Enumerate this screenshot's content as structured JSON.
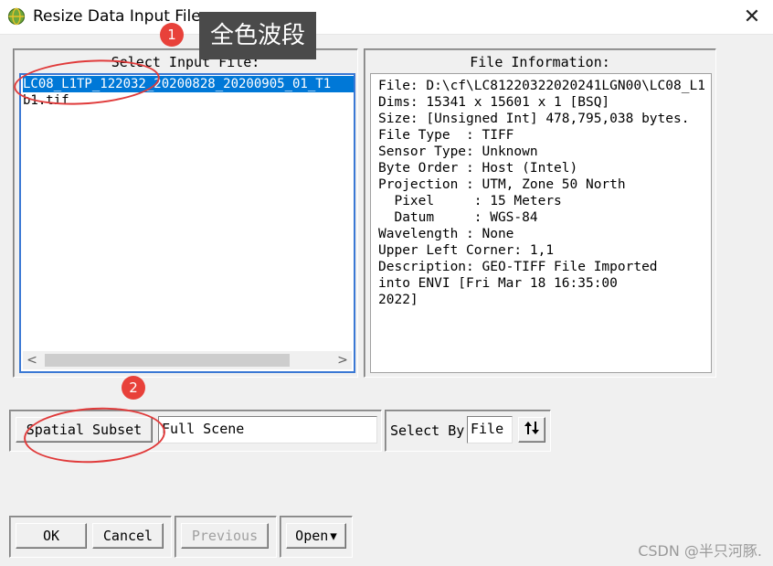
{
  "window": {
    "title": "Resize Data Input File",
    "close_glyph": "✕",
    "app_icon": "envi-globe-icon"
  },
  "input_panel": {
    "label": "Select Input File:",
    "files": [
      {
        "name": "LC08_L1TP_122032_20200828_20200905_01_T1",
        "selected": true
      },
      {
        "name": "b1.tif",
        "selected": false
      }
    ],
    "scroll_left": "<",
    "scroll_right": ">"
  },
  "info_panel": {
    "label": "File Information:",
    "lines": [
      "File: D:\\cf\\LC81220322020241LGN00\\LC08_L1",
      "Dims: 15341 x 15601 x 1 [BSQ]",
      "Size: [Unsigned Int] 478,795,038 bytes.",
      "File Type  : TIFF",
      "Sensor Type: Unknown",
      "Byte Order : Host (Intel)",
      "Projection : UTM, Zone 50 North",
      "  Pixel     : 15 Meters",
      "  Datum     : WGS-84",
      "Wavelength : None",
      "Upper Left Corner: 1,1",
      "Description: GEO-TIFF File Imported",
      "into ENVI [Fri Mar 18 16:35:00",
      "2022]"
    ]
  },
  "subset": {
    "button_label": "Spatial Subset",
    "value": "Full Scene"
  },
  "select_by": {
    "label": "Select By",
    "value": "File",
    "sort_icon": "sort-arrows-icon"
  },
  "actions": {
    "ok": "OK",
    "cancel": "Cancel",
    "previous": "Previous",
    "open": "Open",
    "open_arrow": "▾"
  },
  "annotations": {
    "badge_1": "1",
    "badge_2": "2",
    "callout_text": "全色波段",
    "color": "#e03a3a"
  },
  "watermark": "CSDN @半只河豚."
}
